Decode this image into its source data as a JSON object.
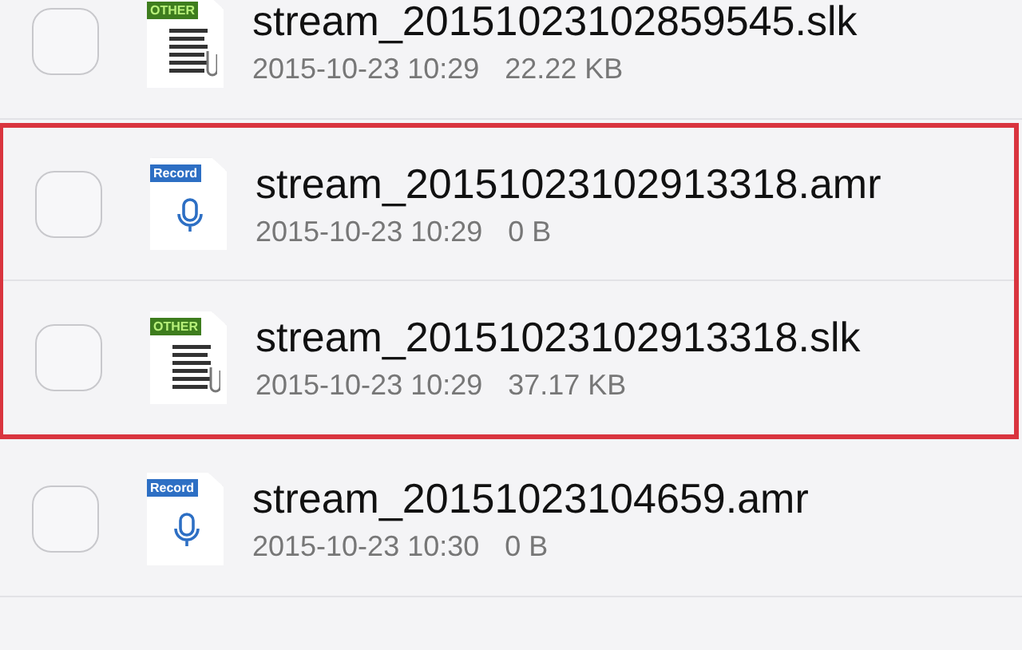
{
  "groups": [
    {
      "highlighted": false,
      "files": [
        {
          "kind": "other",
          "badge": "OTHER",
          "name": "stream_20151023102859545.slk",
          "date": "2015-10-23 10:29",
          "size": "22.22 KB",
          "checked": false
        }
      ]
    },
    {
      "highlighted": true,
      "files": [
        {
          "kind": "record",
          "badge": "Record",
          "name": "stream_20151023102913318.amr",
          "date": "2015-10-23 10:29",
          "size": "0 B",
          "checked": false
        },
        {
          "kind": "other",
          "badge": "OTHER",
          "name": "stream_20151023102913318.slk",
          "date": "2015-10-23 10:29",
          "size": "37.17 KB",
          "checked": false
        }
      ]
    },
    {
      "highlighted": false,
      "files": [
        {
          "kind": "record",
          "badge": "Record",
          "name": "stream_20151023104659.amr",
          "date": "2015-10-23 10:30",
          "size": "0 B",
          "checked": false
        }
      ]
    }
  ]
}
